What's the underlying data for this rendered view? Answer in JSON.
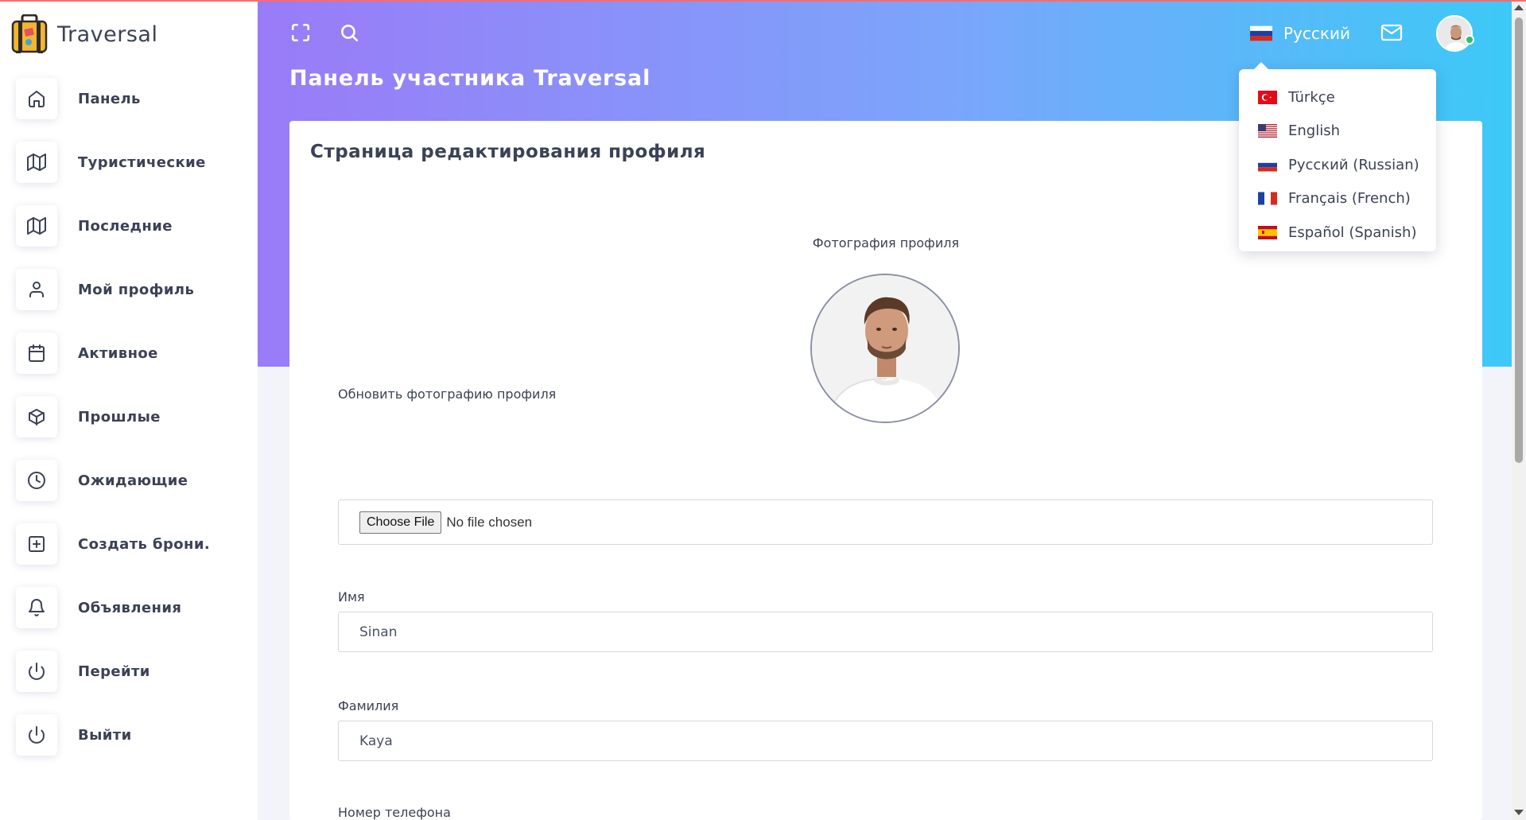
{
  "app": {
    "name": "Traversal"
  },
  "sidebar": {
    "items": [
      {
        "label": "Панель",
        "icon": "home-icon"
      },
      {
        "label": "Туристические",
        "icon": "map-icon"
      },
      {
        "label": "Последние",
        "icon": "map-icon"
      },
      {
        "label": "Мой профиль",
        "icon": "user-icon"
      },
      {
        "label": "Активное",
        "icon": "calendar-icon"
      },
      {
        "label": "Прошлые",
        "icon": "box-icon"
      },
      {
        "label": "Ожидающие",
        "icon": "clock-icon"
      },
      {
        "label": "Создать брони.",
        "icon": "plus-square-icon"
      },
      {
        "label": "Объявления",
        "icon": "bell-icon"
      },
      {
        "label": "Перейти",
        "icon": "power-icon"
      },
      {
        "label": "Выйти",
        "icon": "power-icon"
      }
    ]
  },
  "header": {
    "title": "Панель участника Traversal",
    "current_language": "Русский",
    "icons": [
      "fullscreen-icon",
      "search-icon",
      "mail-icon"
    ]
  },
  "language_menu": {
    "items": [
      {
        "label": "Türkçe",
        "flag": "tr"
      },
      {
        "label": "English",
        "flag": "us"
      },
      {
        "label": "Русский (Russian)",
        "flag": "ru"
      },
      {
        "label": "Français (French)",
        "flag": "fr"
      },
      {
        "label": "Español (Spanish)",
        "flag": "es"
      }
    ]
  },
  "profile_form": {
    "title": "Страница редактирования профиля",
    "photo_label": "Фотография профиля",
    "update_photo_label": "Обновить фотографию профиля",
    "file_button": "Choose File",
    "file_status": "No file chosen",
    "first_name_label": "Имя",
    "first_name_value": "Sinan",
    "last_name_label": "Фамилия",
    "last_name_value": "Kaya",
    "phone_label": "Номер телефона"
  },
  "colors": {
    "gradient_start": "#9a7bf8",
    "gradient_end": "#3dc9f7",
    "text": "#3b4256",
    "online": "#27c26c"
  }
}
